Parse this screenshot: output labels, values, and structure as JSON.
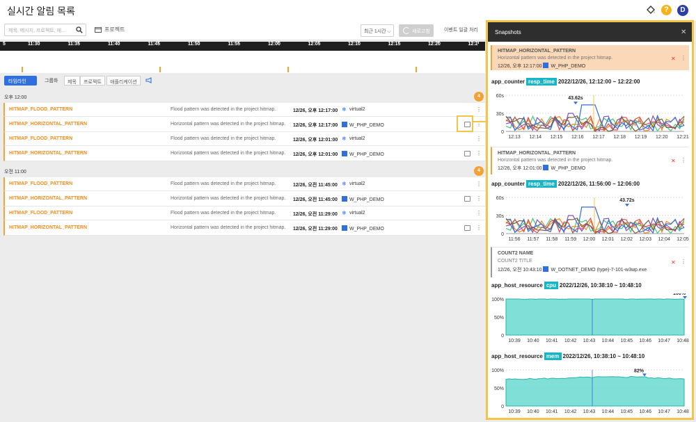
{
  "header": {
    "title": "실시간 알림 목록",
    "help": "?",
    "avatar": "D"
  },
  "toolbar": {
    "search_placeholder": "제목, 메시지, 프로젝트, 에...",
    "project": "프로젝트",
    "range": "최근 1시간 ⌵",
    "refresh": "새로고침",
    "batch": "이벤트 일괄 처리"
  },
  "timeline": {
    "ticks": [
      "5",
      "11:30",
      "11:35",
      "11:40",
      "11:45",
      "11:50",
      "11:55",
      "12:00",
      "12:05",
      "12:10",
      "12:15",
      "12:20",
      "12:2"
    ]
  },
  "tabs": {
    "timeline": "타임라인",
    "group": "그룹화",
    "seg": [
      "제목",
      "프로젝트",
      "애플리케이션"
    ]
  },
  "sections": [
    {
      "label": "오후 12:00",
      "count": "4",
      "rows": [
        {
          "name": "HITMAP_FLOOD_PATTERN",
          "msg": "Flood pattern was detected in the project hitmap.",
          "time": "12/26, 오후 12:17:00",
          "proj": "virtual2",
          "kind": "snow",
          "snap": false
        },
        {
          "name": "HITMAP_HORIZONTAL_PATTERN",
          "msg": "Horizontal pattern was detected in the project hitmap.",
          "time": "12/26, 오후 12:17:00",
          "proj": "W_PHP_DEMO",
          "kind": "php",
          "snap": true
        },
        {
          "name": "HITMAP_FLOOD_PATTERN",
          "msg": "Flood pattern was detected in the project hitmap.",
          "time": "12/26, 오후 12:01:00",
          "proj": "virtual2",
          "kind": "snow",
          "snap": false
        },
        {
          "name": "HITMAP_HORIZONTAL_PATTERN",
          "msg": "Horizontal pattern was detected in the project hitmap.",
          "time": "12/26, 오후 12:01:00",
          "proj": "W_PHP_DEMO",
          "kind": "php",
          "snap": true
        }
      ]
    },
    {
      "label": "오전 11:00",
      "count": "4",
      "rows": [
        {
          "name": "HITMAP_FLOOD_PATTERN",
          "msg": "Flood pattern was detected in the project hitmap.",
          "time": "12/26, 오전 11:45:00",
          "proj": "virtual2",
          "kind": "snow",
          "snap": false
        },
        {
          "name": "HITMAP_HORIZONTAL_PATTERN",
          "msg": "Horizontal pattern was detected in the project hitmap.",
          "time": "12/26, 오전 11:45:00",
          "proj": "W_PHP_DEMO",
          "kind": "php",
          "snap": true
        },
        {
          "name": "HITMAP_FLOOD_PATTERN",
          "msg": "Flood pattern was detected in the project hitmap.",
          "time": "12/26, 오전 11:29:00",
          "proj": "virtual2",
          "kind": "snow",
          "snap": false
        },
        {
          "name": "HITMAP_HORIZONTAL_PATTERN",
          "msg": "Horizontal pattern was detected in the project hitmap.",
          "time": "12/26, 오전 11:29:00",
          "proj": "W_PHP_DEMO",
          "kind": "php",
          "snap": true
        }
      ]
    }
  ],
  "panel": {
    "title": "Snapshots",
    "card1": {
      "name": "HITMAP_HORIZONTAL_PATTERN",
      "msg": "Horizontal pattern was detected in the project hitmap.",
      "time": "12/26, 오후 12:17:00",
      "proj": "W_PHP_DEMO"
    },
    "m1": {
      "name": "app_counter",
      "tag": "resp_time",
      "range": "2022/12/26, 12:12:00 ~ 12:22:00",
      "peak": "43.62s"
    },
    "card2": {
      "name": "HITMAP_HORIZONTAL_PATTERN",
      "msg": "Horizontal pattern was detected in the project hitmap.",
      "time": "12/26, 오후 12:01:00",
      "proj": "W_PHP_DEMO"
    },
    "m2": {
      "name": "app_counter",
      "tag": "resp_time",
      "range": "2022/12/26, 11:56:00 ~ 12:06:00",
      "peak": "43.72s"
    },
    "card3": {
      "name": "COUNT2 NAME",
      "title": "COUNT2 TITLE",
      "time": "12/26, 오전 10:43:10",
      "proj": "W_DOTNET_DEMO",
      "extra": "(type)-7-101-w3wp.exe"
    },
    "m3": {
      "name": "app_host_resource",
      "tag": "cpu",
      "range": "2022/12/26, 10:38:10 ~ 10:48:10",
      "peak": "100%"
    },
    "m4": {
      "name": "app_host_resource",
      "tag": "mem",
      "range": "2022/12/26, 10:38:10 ~ 10:48:10",
      "peak": "82%"
    }
  },
  "chart_data": [
    {
      "type": "line",
      "title": "app_counter resp_time",
      "x": [
        "12:13",
        "12:14",
        "12:15",
        "12:16",
        "12:17",
        "12:18",
        "12:19",
        "12:20",
        "12:21"
      ],
      "yticks": [
        "0",
        "30s",
        "60s"
      ],
      "ylim": [
        0,
        60
      ],
      "peak": 43.62
    },
    {
      "type": "line",
      "title": "app_counter resp_time",
      "x": [
        "11:56",
        "11:57",
        "11:58",
        "11:59",
        "12:00",
        "12:01",
        "12:02",
        "12:03",
        "12:04",
        "12:05"
      ],
      "yticks": [
        "0",
        "30s",
        "60s"
      ],
      "ylim": [
        0,
        60
      ],
      "peak": 43.72
    },
    {
      "type": "area",
      "title": "app_host_resource cpu",
      "x": [
        "10:39",
        "10:40",
        "10:41",
        "10:42",
        "10:43",
        "10:44",
        "10:45",
        "10:46",
        "10:47",
        "10:48"
      ],
      "yticks": [
        "0",
        "50%",
        "100%"
      ],
      "ylim": [
        0,
        100
      ],
      "values": [
        100,
        100,
        100,
        100,
        100,
        100,
        100,
        100,
        100,
        100
      ]
    },
    {
      "type": "area",
      "title": "app_host_resource mem",
      "x": [
        "10:39",
        "10:40",
        "10:41",
        "10:42",
        "10:43",
        "10:44",
        "10:45",
        "10:46",
        "10:47",
        "10:48"
      ],
      "yticks": [
        "0",
        "50%",
        "100%"
      ],
      "ylim": [
        0,
        100
      ],
      "values": [
        74,
        75,
        76,
        77,
        79,
        80,
        80,
        81,
        77,
        76
      ]
    }
  ],
  "colors": {
    "accent": "#f4a236",
    "primary": "#2f6fe0",
    "teal": "#17b6c6",
    "highlight": "#f3c44a"
  }
}
